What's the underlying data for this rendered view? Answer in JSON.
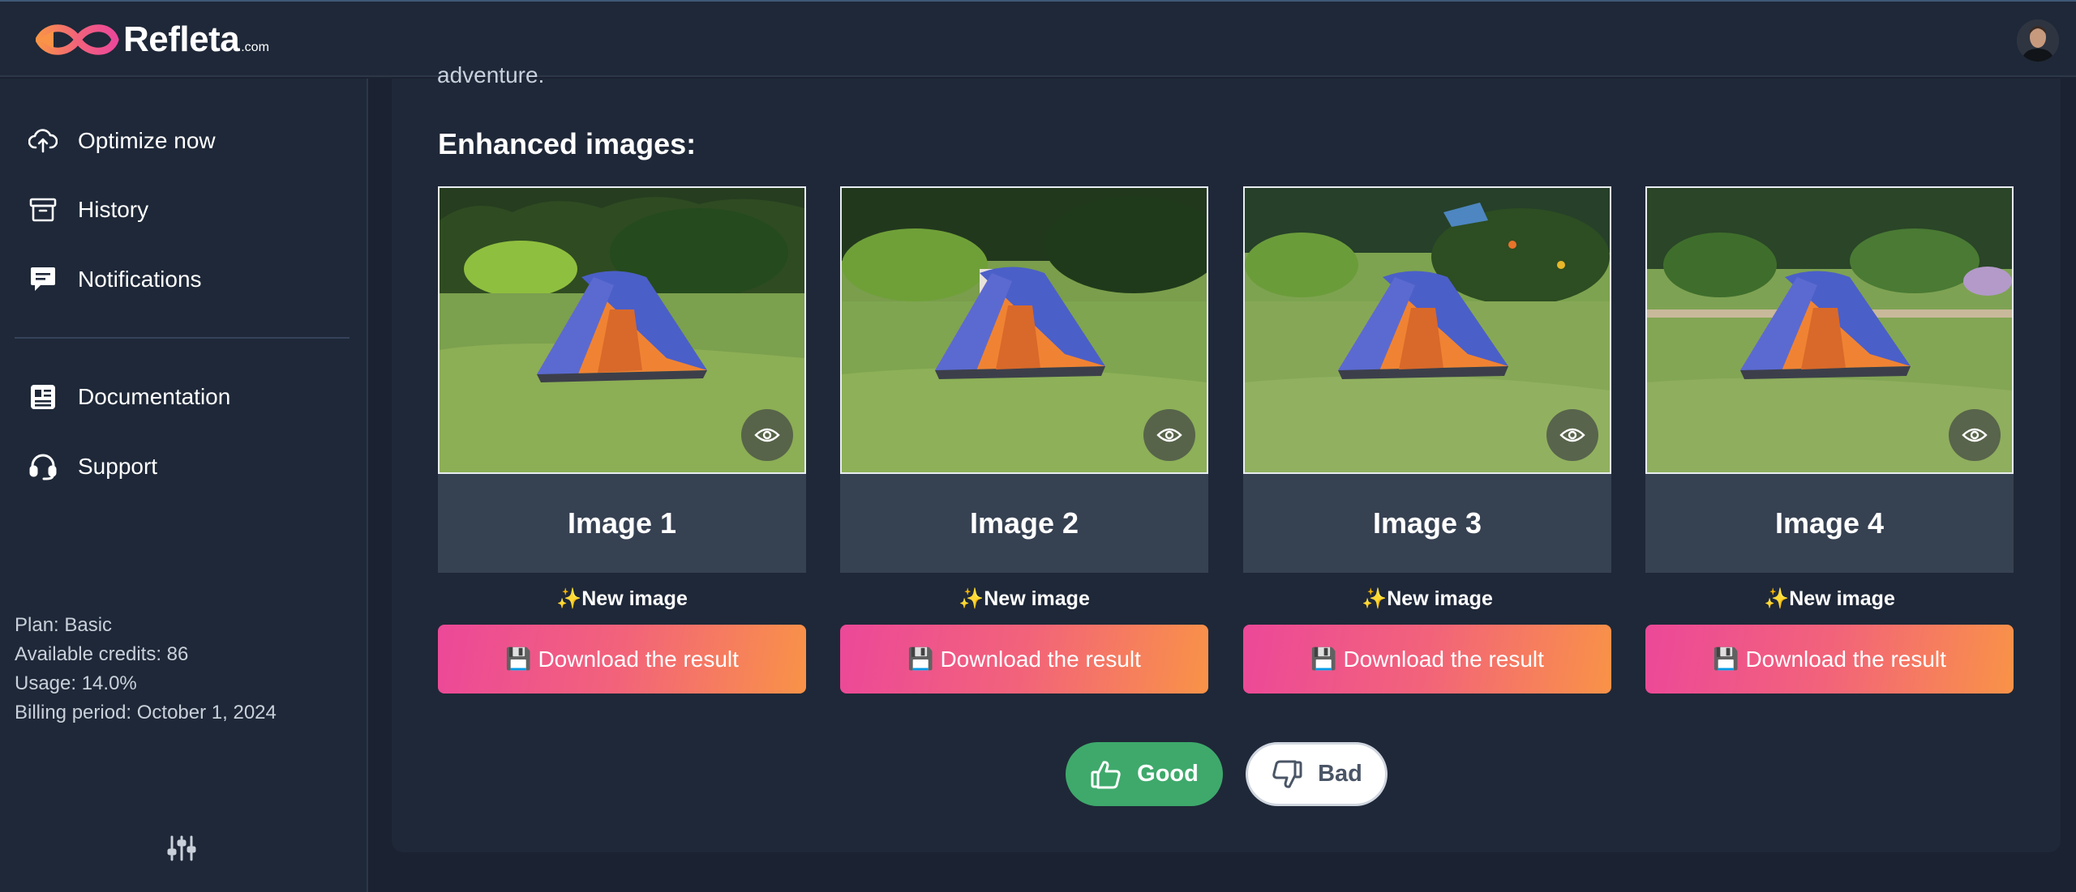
{
  "header": {
    "brand_name": "Refleta",
    "brand_tld": ".com",
    "logo_colors": {
      "pink": "#ec4899",
      "orange": "#f99347"
    }
  },
  "sidebar": {
    "items": [
      {
        "label": "Optimize now",
        "icon": "cloud-upload-icon"
      },
      {
        "label": "History",
        "icon": "archive-icon"
      },
      {
        "label": "Notifications",
        "icon": "message-icon"
      },
      {
        "label": "Documentation",
        "icon": "document-icon"
      },
      {
        "label": "Support",
        "icon": "headset-icon"
      }
    ],
    "plan": {
      "plan_line": "Plan: Basic",
      "credits_line": "Available credits: 86",
      "usage_line": "Usage: 14.0%",
      "billing_line": "Billing period: October 1, 2024"
    },
    "settings_icon": "sliders-icon"
  },
  "main": {
    "partial_text": "adventure.",
    "section_title": "Enhanced images:",
    "images": [
      {
        "label": "Image 1",
        "new_image": "✨New image",
        "download": "Download the result"
      },
      {
        "label": "Image 2",
        "new_image": "✨New image",
        "download": "Download the result"
      },
      {
        "label": "Image 3",
        "new_image": "✨New image",
        "download": "Download the result"
      },
      {
        "label": "Image 4",
        "new_image": "✨New image",
        "download": "Download the result"
      }
    ],
    "download_icon": "💾",
    "feedback": {
      "good": "Good",
      "bad": "Bad"
    }
  },
  "colors": {
    "background": "#1b2231",
    "panel": "#1f2838",
    "label_box": "#364152",
    "good_button": "#3ea96b",
    "download_gradient_start": "#ec4899",
    "download_gradient_end": "#f99347"
  }
}
